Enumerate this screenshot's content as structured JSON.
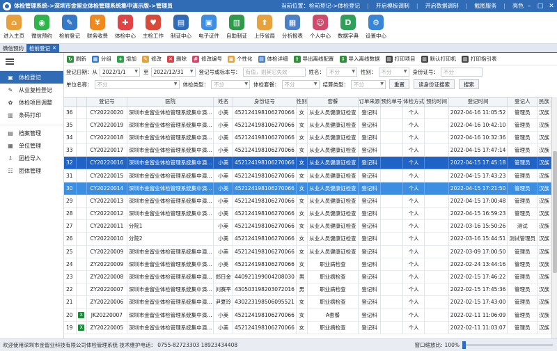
{
  "titlebar": {
    "title": "体检管理系统->深圳市金留业体检管理系统集中演示版->管理员",
    "location": "当前位置：检前登记->体检登记",
    "links": [
      "开启模板调制",
      "开启数据调制",
      "截图服务",
      "亮色"
    ]
  },
  "toolbar": {
    "items": [
      {
        "label": "进入主页",
        "icon": "home-icon",
        "color": "#e8a13a",
        "glyph": "⌂"
      },
      {
        "label": "微信预约",
        "icon": "wechat-icon",
        "color": "#2fb34a",
        "glyph": "◉"
      },
      {
        "label": "检前登记",
        "icon": "register-icon",
        "color": "#3478c8",
        "glyph": "✎"
      },
      {
        "label": "财务收费",
        "icon": "money-icon",
        "color": "#f08a1f",
        "glyph": "¥"
      },
      {
        "label": "体检中心",
        "icon": "medical-icon",
        "color": "#e04444",
        "glyph": "✚"
      },
      {
        "label": "主检工作",
        "icon": "doctor-icon",
        "color": "#d84a3a",
        "glyph": "♥"
      },
      {
        "label": "制证中心",
        "icon": "printer-icon",
        "color": "#2f6cb5",
        "glyph": "▤"
      },
      {
        "label": "电子证件",
        "icon": "certificate-icon",
        "color": "#3c8ee0",
        "glyph": "▣"
      },
      {
        "label": "自助制证",
        "icon": "kiosk-icon",
        "color": "#2f9a4a",
        "glyph": "▥"
      },
      {
        "label": "上传省局",
        "icon": "upload-icon",
        "color": "#e6a23c",
        "glyph": "⬆"
      },
      {
        "label": "分析报表",
        "icon": "chart-icon",
        "color": "#4c7fc4",
        "glyph": "▦"
      },
      {
        "label": "个人中心",
        "icon": "user-icon",
        "color": "#d04a6a",
        "glyph": "☺"
      },
      {
        "label": "数据字典",
        "icon": "dictionary-icon",
        "color": "#2fa05a",
        "glyph": "D"
      },
      {
        "label": "设置中心",
        "icon": "gear-icon",
        "color": "#3a86d6",
        "glyph": "⚙"
      }
    ]
  },
  "tabs": [
    {
      "label": "微信预约",
      "active": false
    },
    {
      "label": "检前登记",
      "active": true
    }
  ],
  "sidebar": {
    "items": [
      {
        "label": "体检登记",
        "icon": "register-icon",
        "glyph": "▣",
        "active": true
      },
      {
        "label": "从业复检登记",
        "icon": "recheck-icon",
        "glyph": "✎",
        "active": false
      },
      {
        "label": "体检项目调整",
        "icon": "adjust-icon",
        "glyph": "✿",
        "active": false
      },
      {
        "label": "条码打印",
        "icon": "barcode-icon",
        "glyph": "▥",
        "active": false
      },
      {
        "label": "档案管理",
        "icon": "archive-icon",
        "glyph": "▤",
        "active": false
      },
      {
        "label": "单位管理",
        "icon": "company-icon",
        "glyph": "▦",
        "active": false
      },
      {
        "label": "团检导入",
        "icon": "import-icon",
        "glyph": "⇩",
        "active": false
      },
      {
        "label": "团体管理",
        "icon": "group-icon",
        "glyph": "☷",
        "active": false
      }
    ]
  },
  "actions": [
    {
      "label": "刷新",
      "icon": "refresh-icon",
      "color": "#2f8f3a",
      "glyph": "↻"
    },
    {
      "label": "分组",
      "icon": "group-icon",
      "color": "#3478c8",
      "glyph": "▦"
    },
    {
      "label": "增加",
      "icon": "add-icon",
      "color": "#2ca04a",
      "glyph": "+"
    },
    {
      "label": "修改",
      "icon": "edit-icon",
      "color": "#e6a23c",
      "glyph": "✎"
    },
    {
      "label": "删除",
      "icon": "delete-icon",
      "color": "#d9434a",
      "glyph": "✕"
    },
    {
      "label": "修改编号",
      "icon": "renumber-icon",
      "color": "#d04a6a",
      "glyph": "#"
    },
    {
      "label": "个性化",
      "icon": "custom-icon",
      "color": "#e6a23c",
      "glyph": "▣"
    },
    {
      "label": "体检详细",
      "icon": "detail-icon",
      "color": "#4c7fc4",
      "glyph": "▤"
    },
    {
      "label": "导出离线配置",
      "icon": "export-icon",
      "color": "#2f8f3a",
      "glyph": "⇧"
    },
    {
      "label": "导入离线数据",
      "icon": "import-icon",
      "color": "#2f8f3a",
      "glyph": "⇩"
    },
    {
      "label": "打印项目",
      "icon": "print-icon",
      "color": "#444444",
      "glyph": "▥"
    },
    {
      "label": "默认打印机",
      "icon": "printer-icon",
      "color": "#444444",
      "glyph": "▥"
    },
    {
      "label": "打印指引表",
      "icon": "print-guide-icon",
      "color": "#444444",
      "glyph": "▥"
    }
  ],
  "filters": {
    "date_label": "登记日期：从",
    "date_from": "2022/1/1",
    "date_to_label": "至",
    "date_to": "2022/12/31",
    "regno_label": "登记号或标本号：",
    "regno_placeholder": "有值，则其它失效",
    "name_label": "姓名：",
    "all": "不分",
    "gender_label": "性别：",
    "idcard_label": "身份证号：",
    "unit_label": "单位名称：",
    "exam_type_label": "体检类型：",
    "package_label": "体检套餐：",
    "settle_label": "结算类型：",
    "btn_reset": "重置",
    "btn_read_id": "读身份证搜索",
    "btn_search": "搜索"
  },
  "table": {
    "columns": [
      "",
      "",
      "登记号",
      "医院",
      "姓名",
      "身份证号",
      "性别",
      "套餐",
      "订单来源",
      "预约单号",
      "体检方式",
      "预约时间",
      "登记时间",
      "登记人",
      "民族"
    ],
    "rows": [
      {
        "num": "36",
        "icon": false,
        "regno": "CY20220020",
        "hospital": "深圳市金留业体检管理系统集中演...",
        "name": "小美",
        "id": "452124198106270066",
        "gender": "女",
        "package": "从业人员健康证检查",
        "source": "登记科",
        "order": "",
        "mode": "个人",
        "appt": "",
        "time": "2022-04-16 11:05:52",
        "user": "管理员",
        "nation": "汉族",
        "sel": ""
      },
      {
        "num": "35",
        "icon": false,
        "regno": "CY20220019",
        "hospital": "深圳市金留业体检管理系统集中演...",
        "name": "小美",
        "id": "452124198106270066",
        "gender": "女",
        "package": "从业人员健康证检查",
        "source": "登记科",
        "order": "",
        "mode": "个人",
        "appt": "",
        "time": "2022-04-16 10:42:10",
        "user": "管理员",
        "nation": "汉族",
        "sel": ""
      },
      {
        "num": "34",
        "icon": false,
        "regno": "CY20220018",
        "hospital": "深圳市金留业体检管理系统集中演...",
        "name": "小美",
        "id": "452124198106270066",
        "gender": "女",
        "package": "从业人员健康证检查",
        "source": "登记科",
        "order": "",
        "mode": "个人",
        "appt": "",
        "time": "2022-04-16 10:32:36",
        "user": "管理员",
        "nation": "汉族",
        "sel": ""
      },
      {
        "num": "33",
        "icon": false,
        "regno": "CY20220017",
        "hospital": "深圳市金留业体检管理系统集中演...",
        "name": "小美",
        "id": "452124198106270066",
        "gender": "女",
        "package": "从业人员健康证检查",
        "source": "登记科",
        "order": "",
        "mode": "个人",
        "appt": "",
        "time": "2022-04-15 17:47:14",
        "user": "管理员",
        "nation": "汉族",
        "sel": ""
      },
      {
        "num": "32",
        "icon": false,
        "regno": "CY20220016",
        "hospital": "深圳市金留业体检管理系统集中演...",
        "name": "小美",
        "id": "452124198106270066",
        "gender": "女",
        "package": "从业人员健康证检查",
        "source": "登记科",
        "order": "",
        "mode": "个人",
        "appt": "",
        "time": "2022-04-15 17:45:18",
        "user": "管理员",
        "nation": "汉族",
        "sel": "sel"
      },
      {
        "num": "31",
        "icon": false,
        "regno": "CY20220015",
        "hospital": "深圳市金留业体检管理系统集中演...",
        "name": "小美",
        "id": "452124198106270066",
        "gender": "女",
        "package": "从业人员健康证检查",
        "source": "登记科",
        "order": "",
        "mode": "个人",
        "appt": "",
        "time": "2022-04-15 17:43:23",
        "user": "管理员",
        "nation": "汉族",
        "sel": ""
      },
      {
        "num": "30",
        "icon": false,
        "regno": "CY20220014",
        "hospital": "深圳市金留业体检管理系统集中演...",
        "name": "小美",
        "id": "452124198106270066",
        "gender": "女",
        "package": "从业人员健康证检查",
        "source": "登记科",
        "order": "",
        "mode": "个人",
        "appt": "",
        "time": "2022-04-15 17:21:50",
        "user": "管理员",
        "nation": "汉族",
        "sel": "sel2"
      },
      {
        "num": "29",
        "icon": false,
        "regno": "CY20220013",
        "hospital": "深圳市金留业体检管理系统集中演...",
        "name": "小美",
        "id": "452124198106270066",
        "gender": "女",
        "package": "从业人员健康证检查",
        "source": "登记科",
        "order": "",
        "mode": "个人",
        "appt": "",
        "time": "2022-04-15 17:00:48",
        "user": "管理员",
        "nation": "汉族",
        "sel": ""
      },
      {
        "num": "28",
        "icon": false,
        "regno": "CY20220012",
        "hospital": "深圳市金留业体检管理系统集中演...",
        "name": "小美",
        "id": "452124198106270066",
        "gender": "女",
        "package": "从业人员健康证检查",
        "source": "登记科",
        "order": "",
        "mode": "个人",
        "appt": "",
        "time": "2022-04-15 16:59:23",
        "user": "管理员",
        "nation": "汉族",
        "sel": ""
      },
      {
        "num": "27",
        "icon": false,
        "regno": "CY20220011",
        "hospital": "分院1",
        "name": "小美",
        "id": "452124198106270066",
        "gender": "女",
        "package": "从业人员健康证检查",
        "source": "登记科",
        "order": "",
        "mode": "个人",
        "appt": "",
        "time": "2022-03-16 15:50:26",
        "user": "测试",
        "nation": "汉族",
        "sel": ""
      },
      {
        "num": "26",
        "icon": false,
        "regno": "CY20220010",
        "hospital": "分院2",
        "name": "小美",
        "id": "452124198106270066",
        "gender": "女",
        "package": "从业人员健康证检查",
        "source": "登记科",
        "order": "",
        "mode": "个人",
        "appt": "",
        "time": "2022-03-16 15:44:51",
        "user": "测试管理员",
        "nation": "汉族",
        "sel": ""
      },
      {
        "num": "25",
        "icon": false,
        "regno": "CY20220009",
        "hospital": "深圳市金留业体检管理系统集中演...",
        "name": "小美",
        "id": "452124198106270066",
        "gender": "女",
        "package": "从业人员健康证检查",
        "source": "登记科",
        "order": "",
        "mode": "个人",
        "appt": "",
        "time": "2022-03-09 17:00:50",
        "user": "管理员",
        "nation": "汉族",
        "sel": ""
      },
      {
        "num": "24",
        "icon": false,
        "regno": "ZY20220009",
        "hospital": "深圳市金留业体检管理系统集中演...",
        "name": "小美",
        "id": "452124198106270066",
        "gender": "女",
        "package": "职业病检查",
        "source": "登记科",
        "order": "",
        "mode": "个人",
        "appt": "",
        "time": "2022-02-24 13:44:16",
        "user": "管理员",
        "nation": "汉族",
        "sel": ""
      },
      {
        "num": "23",
        "icon": false,
        "regno": "ZY20220008",
        "hospital": "深圳市金留业体检管理系统集中演...",
        "name": "郑日金",
        "id": "440921199004208030",
        "gender": "男",
        "package": "职业病检查",
        "source": "登记科",
        "order": "",
        "mode": "个人",
        "appt": "",
        "time": "2022-02-15 17:46:22",
        "user": "管理员",
        "nation": "汉族",
        "sel": ""
      },
      {
        "num": "22",
        "icon": false,
        "regno": "ZY20220007",
        "hospital": "深圳市金留业体检管理系统集中演...",
        "name": "刘赛平",
        "id": "430503198203072016",
        "gender": "男",
        "package": "职业病检查",
        "source": "登记科",
        "order": "",
        "mode": "个人",
        "appt": "",
        "time": "2022-02-15 17:45:36",
        "user": "管理员",
        "nation": "汉族",
        "sel": ""
      },
      {
        "num": "21",
        "icon": false,
        "regno": "ZY20220006",
        "hospital": "深圳市金留业体检管理系统集中演...",
        "name": "尹夏玲",
        "id": "430223198506095521",
        "gender": "女",
        "package": "职业病检查",
        "source": "登记科",
        "order": "",
        "mode": "个人",
        "appt": "",
        "time": "2022-02-15 17:43:00",
        "user": "管理员",
        "nation": "汉族",
        "sel": ""
      },
      {
        "num": "20",
        "icon": true,
        "regno": "JK20220007",
        "hospital": "深圳市金留业体检管理系统集中演...",
        "name": "小美",
        "id": "452124198106270066",
        "gender": "女",
        "package": "A套餐",
        "source": "登记科",
        "order": "",
        "mode": "个人",
        "appt": "",
        "time": "2022-02-11 11:06:09",
        "user": "管理员",
        "nation": "汉族",
        "sel": ""
      },
      {
        "num": "19",
        "icon": true,
        "regno": "ZY20220005",
        "hospital": "深圳市金留业体检管理系统集中演...",
        "name": "小美",
        "id": "452124198106270066",
        "gender": "女",
        "package": "职业病检查",
        "source": "登记科",
        "order": "",
        "mode": "个人",
        "appt": "",
        "time": "2022-02-11 11:03:07",
        "user": "管理员",
        "nation": "汉族",
        "sel": ""
      }
    ]
  },
  "status": {
    "text": "欢迎使用深圳市金留业科技有限公司体检管理系统  技术维护电话：  0755-82723303    18923434408",
    "zoom_label": "窗口缩放比:",
    "zoom_value": "100%"
  },
  "colors": {
    "primary": "#2f6cb5",
    "selected_row": "#1f63c6",
    "selected_row_alt": "#3c8ee0"
  }
}
